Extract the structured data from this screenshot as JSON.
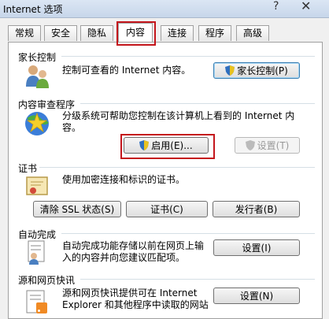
{
  "window": {
    "title": "Internet 选项",
    "help_glyph": "?",
    "close_glyph": "✕"
  },
  "tabs": [
    "常规",
    "安全",
    "隐私",
    "内容",
    "连接",
    "程序",
    "高级"
  ],
  "active_tab": "内容",
  "sections": {
    "parental": {
      "title": "家长控制",
      "desc": "控制可查看的 Internet 内容。",
      "button": "家长控制(P)"
    },
    "advisor": {
      "title": "内容审查程序",
      "desc_line1": "分级系统可帮助您控制在该计算机上看到的 Internet 内",
      "desc_line2": "容。",
      "enable_button": "启用(E)...",
      "settings_button": "设置(T)"
    },
    "certificates": {
      "title": "证书",
      "desc": "使用加密连接和标识的证书。",
      "clear_ssl_button": "清除 SSL 状态(S)",
      "certs_button": "证书(C)",
      "publishers_button": "发行者(B)"
    },
    "autocomplete": {
      "title": "自动完成",
      "desc_line1": "自动完成功能存储以前在网页上输",
      "desc_line2": "入的内容并向您建议匹配项。",
      "settings_button": "设置(I)"
    },
    "feeds": {
      "title": "源和网页快讯",
      "desc_line1": "源和网页快讯提供可在 Internet",
      "desc_line2": "Explorer 和其他程序中读取的网站",
      "settings_button": "设置(N)"
    }
  },
  "colors": {
    "highlight_border": "#c4161c",
    "panel_bg": "#ffffff",
    "dialog_bg": "#f0f0f0"
  }
}
